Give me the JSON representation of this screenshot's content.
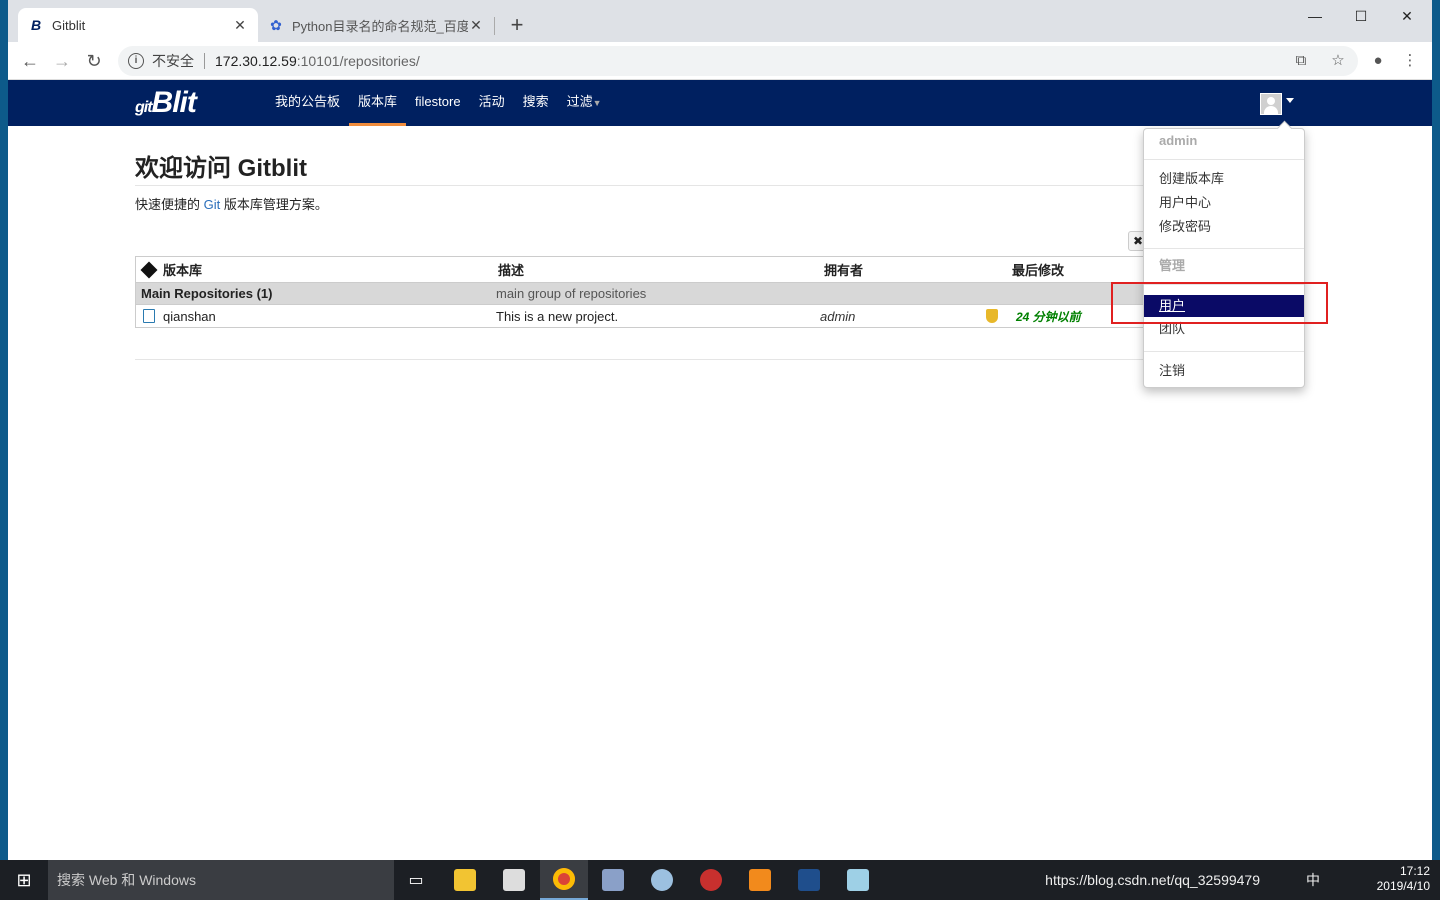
{
  "browser": {
    "tabs": [
      {
        "label": "Gitblit",
        "favicon": "gitblit-icon",
        "active": true
      },
      {
        "label": "Python目录名的命名规范_百度搜",
        "favicon": "baidu-paw-icon",
        "active": false
      }
    ],
    "new_tab": "+",
    "window_controls": {
      "minimize": "—",
      "maximize": "☐",
      "close": "✕"
    },
    "address": {
      "security_label": "不安全",
      "host": "172.30.12.59",
      "path": ":10101/repositories/"
    }
  },
  "gitblit": {
    "logo": "Blit",
    "logo_prefix": "git",
    "nav": [
      {
        "label": "我的公告板",
        "active": false
      },
      {
        "label": "版本库",
        "active": true
      },
      {
        "label": "filestore",
        "active": false
      },
      {
        "label": "活动",
        "active": false
      },
      {
        "label": "搜索",
        "active": false
      },
      {
        "label": "过滤",
        "active": false,
        "has_caret": true
      }
    ],
    "page_title": "欢迎访问 Gitblit",
    "subtitle_before": "快速便捷的 ",
    "subtitle_git": "Git",
    "subtitle_after": " 版本库管理方案。",
    "table": {
      "headers": [
        "版本库",
        "描述",
        "拥有者",
        "最后修改"
      ],
      "groups": [
        {
          "name": "Main Repositories (1)",
          "description": "main group of repositories",
          "rows": [
            {
              "name": "qianshan",
              "description": "This is a new project.",
              "owner": "admin",
              "last_change": "24 分钟以前"
            }
          ]
        }
      ]
    },
    "user_menu": {
      "username": "admin",
      "items": [
        "创建版本库",
        "用户中心",
        "修改密码"
      ],
      "admin_header": "管理",
      "admin_items": [
        "用户",
        "团队"
      ],
      "selected": "用户",
      "logout": "注销"
    }
  },
  "taskbar": {
    "search_placeholder": "搜索 Web 和 Windows",
    "tray_text": "https://blog.csdn.net/qq_32599479",
    "time": "17:12",
    "date": "2019/4/10",
    "ime": "中"
  }
}
